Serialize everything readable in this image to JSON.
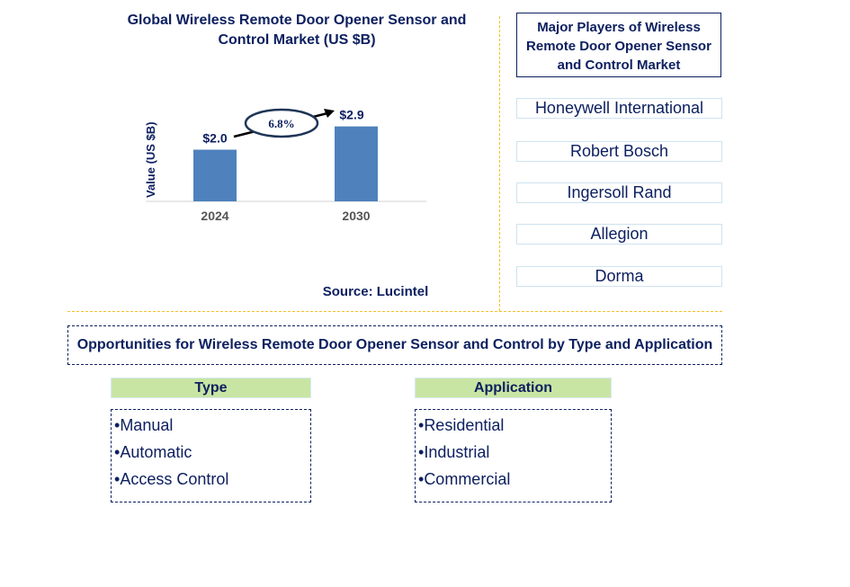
{
  "chart": {
    "title": "Global Wireless Remote Door Opener Sensor and Control Market (US $B)",
    "source": "Source: Lucintel"
  },
  "chart_data": {
    "type": "bar",
    "title": "Global Wireless Remote Door Opener Sensor and Control Market (US $B)",
    "categories": [
      "2024",
      "2030"
    ],
    "values": [
      2.0,
      2.9
    ],
    "data_labels": [
      "$2.0",
      "$2.9"
    ],
    "xlabel": "",
    "ylabel": "Value (US $B)",
    "ylim": [
      0,
      3.2
    ],
    "grid": false,
    "annotation": {
      "text": "6.8%",
      "meaning": "CAGR 2024-2030"
    },
    "bar_color": "#4f81bd"
  },
  "players": {
    "title": "Major Players of Wireless Remote Door Opener Sensor and Control Market",
    "items": [
      "Honeywell International",
      "Robert Bosch",
      "Ingersoll Rand",
      "Allegion",
      "Dorma"
    ]
  },
  "opportunities": {
    "title": "Opportunities for Wireless Remote Door Opener Sensor and Control by Type and Application",
    "type": {
      "heading": "Type",
      "items": [
        "Manual",
        "Automatic",
        "Access Control"
      ]
    },
    "application": {
      "heading": "Application",
      "items": [
        "Residential",
        "Industrial",
        "Commercial"
      ]
    }
  },
  "colors": {
    "text": "#0d2060",
    "bar": "#4f81bd",
    "divider": "#f5c02a",
    "category_header": "#c9e5a3"
  }
}
